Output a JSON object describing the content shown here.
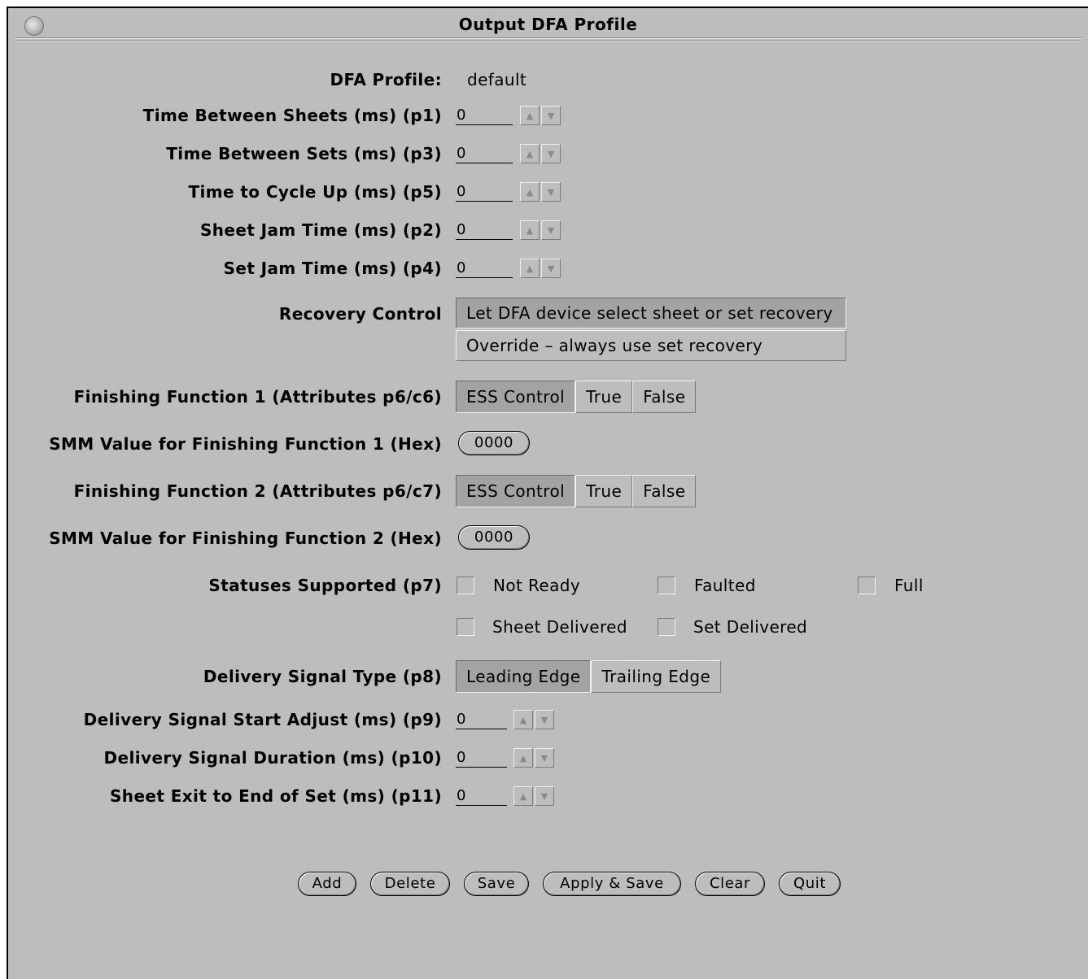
{
  "window": {
    "title": "Output DFA Profile"
  },
  "profile": {
    "label": "DFA Profile:",
    "value": "default"
  },
  "timing": [
    {
      "label": "Time Between Sheets (ms) (p1)",
      "value": "0"
    },
    {
      "label": "Time Between Sets (ms) (p3)",
      "value": "0"
    },
    {
      "label": "Time to Cycle Up (ms) (p5)",
      "value": "0"
    },
    {
      "label": "Sheet Jam Time (ms) (p2)",
      "value": "0"
    },
    {
      "label": "Set Jam Time (ms) (p4)",
      "value": "0"
    }
  ],
  "recovery": {
    "label": "Recovery Control",
    "options": [
      "Let DFA device select sheet or set recovery",
      "Override – always use set recovery"
    ],
    "selected": "Let DFA device select sheet or set recovery"
  },
  "finishing1": {
    "label": "Finishing Function 1 (Attributes p6/c6)",
    "options": [
      "ESS Control",
      "True",
      "False"
    ],
    "selected": "ESS Control"
  },
  "smm1": {
    "label": "SMM Value for Finishing Function 1 (Hex)",
    "value": "0000"
  },
  "finishing2": {
    "label": "Finishing Function 2 (Attributes p6/c7)",
    "options": [
      "ESS Control",
      "True",
      "False"
    ],
    "selected": "ESS Control"
  },
  "smm2": {
    "label": "SMM Value for Finishing Function 2 (Hex)",
    "value": "0000"
  },
  "statuses": {
    "label": "Statuses Supported (p7)",
    "items": [
      {
        "label": "Not Ready",
        "checked": false
      },
      {
        "label": "Faulted",
        "checked": false
      },
      {
        "label": "Full",
        "checked": false
      },
      {
        "label": "Sheet Delivered",
        "checked": false
      },
      {
        "label": "Set Delivered",
        "checked": false
      }
    ]
  },
  "delivery_type": {
    "label": "Delivery Signal Type (p8)",
    "options": [
      "Leading Edge",
      "Trailing Edge"
    ],
    "selected": "Leading Edge"
  },
  "delivery": [
    {
      "label": "Delivery Signal Start Adjust (ms) (p9)",
      "value": "0"
    },
    {
      "label": "Delivery Signal Duration (ms) (p10)",
      "value": "0"
    },
    {
      "label": "Sheet Exit to End of Set (ms) (p11)",
      "value": "0"
    }
  ],
  "buttons": [
    "Add",
    "Delete",
    "Save",
    "Apply & Save",
    "Clear",
    "Quit"
  ]
}
